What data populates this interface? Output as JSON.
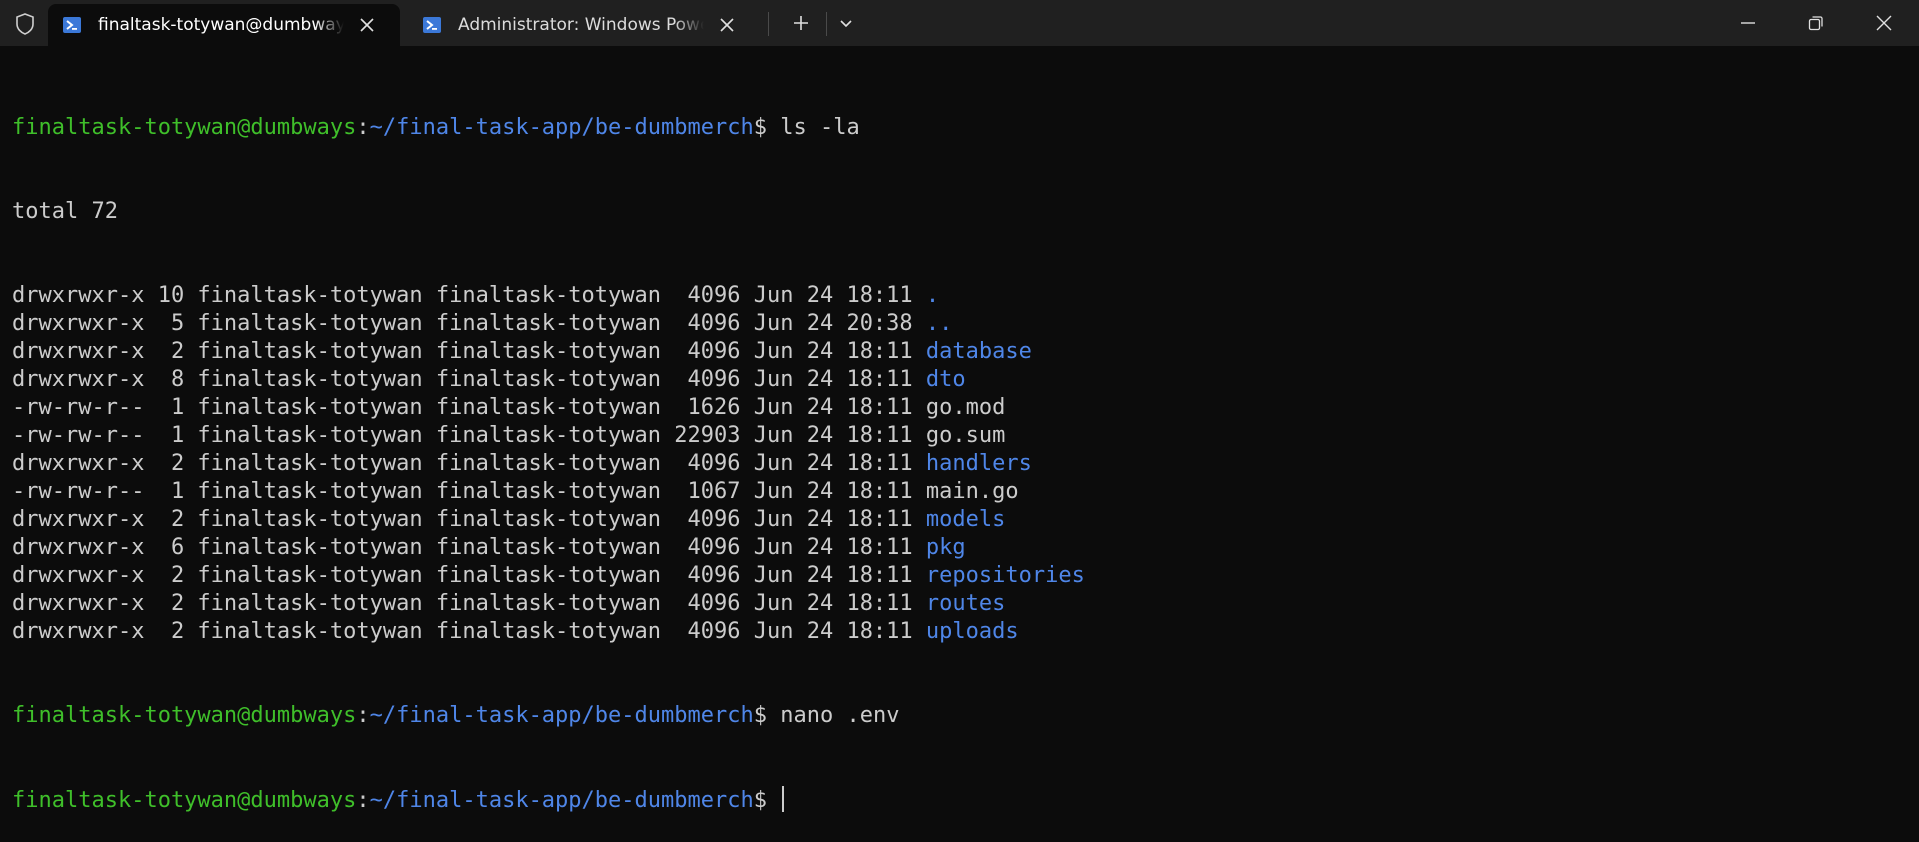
{
  "tabs": [
    {
      "title": "finaltask-totywan@dumbways: ~/final-task-app/be-dumbmerch",
      "active": true
    },
    {
      "title": "Administrator: Windows PowerShell",
      "active": false
    }
  ],
  "icons": {
    "shield": "shield-icon",
    "powershell": "powershell-icon",
    "close": "close-icon",
    "new_tab": "plus-icon",
    "dropdown": "chevron-down-icon",
    "minimize": "minimize-icon",
    "maximize": "restore-icon",
    "window_close": "close-icon"
  },
  "colors": {
    "prompt_user": "#3fbf2a",
    "prompt_path": "#4f86e8",
    "directory": "#4f86e8",
    "text": "#cccccc",
    "background": "#0c0c0c",
    "titlebar": "#202020"
  },
  "prompt": {
    "user_host": "finaltask-totywan@dumbways",
    "colon": ":",
    "path": "~/final-task-app/be-dumbmerch",
    "symbol": "$"
  },
  "commands": {
    "first": " ls -la",
    "second": " nano .env",
    "third": " "
  },
  "listing": {
    "total": "total 72",
    "entries": [
      {
        "meta": "drwxrwxr-x 10 finaltask-totywan finaltask-totywan  4096 Jun 24 18:11 ",
        "name": ".",
        "dir": true
      },
      {
        "meta": "drwxrwxr-x  5 finaltask-totywan finaltask-totywan  4096 Jun 24 20:38 ",
        "name": "..",
        "dir": true
      },
      {
        "meta": "drwxrwxr-x  2 finaltask-totywan finaltask-totywan  4096 Jun 24 18:11 ",
        "name": "database",
        "dir": true
      },
      {
        "meta": "drwxrwxr-x  8 finaltask-totywan finaltask-totywan  4096 Jun 24 18:11 ",
        "name": "dto",
        "dir": true
      },
      {
        "meta": "-rw-rw-r--  1 finaltask-totywan finaltask-totywan  1626 Jun 24 18:11 ",
        "name": "go.mod",
        "dir": false
      },
      {
        "meta": "-rw-rw-r--  1 finaltask-totywan finaltask-totywan 22903 Jun 24 18:11 ",
        "name": "go.sum",
        "dir": false
      },
      {
        "meta": "drwxrwxr-x  2 finaltask-totywan finaltask-totywan  4096 Jun 24 18:11 ",
        "name": "handlers",
        "dir": true
      },
      {
        "meta": "-rw-rw-r--  1 finaltask-totywan finaltask-totywan  1067 Jun 24 18:11 ",
        "name": "main.go",
        "dir": false
      },
      {
        "meta": "drwxrwxr-x  2 finaltask-totywan finaltask-totywan  4096 Jun 24 18:11 ",
        "name": "models",
        "dir": true
      },
      {
        "meta": "drwxrwxr-x  6 finaltask-totywan finaltask-totywan  4096 Jun 24 18:11 ",
        "name": "pkg",
        "dir": true
      },
      {
        "meta": "drwxrwxr-x  2 finaltask-totywan finaltask-totywan  4096 Jun 24 18:11 ",
        "name": "repositories",
        "dir": true
      },
      {
        "meta": "drwxrwxr-x  2 finaltask-totywan finaltask-totywan  4096 Jun 24 18:11 ",
        "name": "routes",
        "dir": true
      },
      {
        "meta": "drwxrwxr-x  2 finaltask-totywan finaltask-totywan  4096 Jun 24 18:11 ",
        "name": "uploads",
        "dir": true
      }
    ]
  }
}
